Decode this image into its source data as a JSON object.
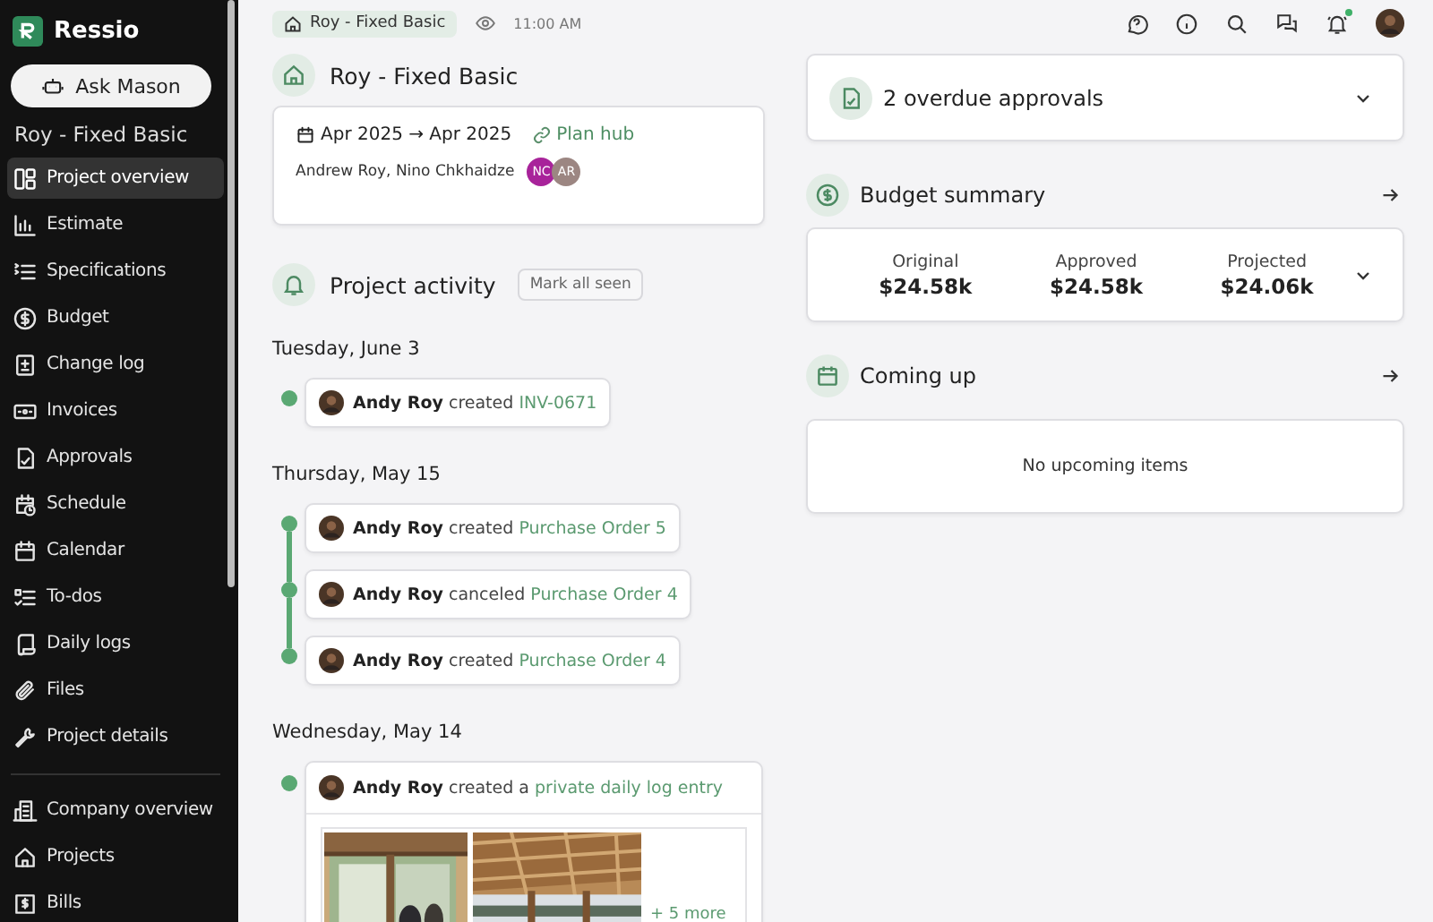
{
  "app": {
    "name": "Ressio"
  },
  "ask_button": {
    "label": "Ask Mason"
  },
  "sidebar_project": "Roy - Fixed Basic",
  "project_nav": [
    {
      "label": "Project overview",
      "selected": true
    },
    {
      "label": "Estimate",
      "selected": false
    },
    {
      "label": "Specifications",
      "selected": false
    },
    {
      "label": "Budget",
      "selected": false
    },
    {
      "label": "Change log",
      "selected": false
    },
    {
      "label": "Invoices",
      "selected": false
    },
    {
      "label": "Approvals",
      "selected": false
    },
    {
      "label": "Schedule",
      "selected": false
    },
    {
      "label": "Calendar",
      "selected": false
    },
    {
      "label": "To-dos",
      "selected": false
    },
    {
      "label": "Daily logs",
      "selected": false
    },
    {
      "label": "Files",
      "selected": false
    },
    {
      "label": "Project details",
      "selected": false
    }
  ],
  "company_nav": [
    {
      "label": "Company overview",
      "selected": false
    },
    {
      "label": "Projects",
      "selected": false
    },
    {
      "label": "Bills",
      "selected": false
    }
  ],
  "header": {
    "breadcrumb": "Roy - Fixed Basic",
    "time": "11:00 AM",
    "bell_unread": true
  },
  "project": {
    "title": "Roy - Fixed Basic",
    "dates": "Apr 2025 → Apr 2025",
    "plan_link": "Plan hub",
    "members": "Andrew Roy, Nino Chkhaidze",
    "avatars": [
      {
        "initials": "NC",
        "color": "#a8239a"
      },
      {
        "initials": "AR",
        "color": "#9c8682"
      }
    ]
  },
  "activity": {
    "title": "Project activity",
    "mark_button": "Mark all seen",
    "days": [
      {
        "date": "Tuesday, June 3",
        "entries": [
          {
            "actor": "Andy Roy",
            "action": "created",
            "link": "INV-0671"
          }
        ]
      },
      {
        "date": "Thursday, May 15",
        "entries": [
          {
            "actor": "Andy Roy",
            "action": "created",
            "link": "Purchase Order 5"
          },
          {
            "actor": "Andy Roy",
            "action": "canceled",
            "link": "Purchase Order 4"
          },
          {
            "actor": "Andy Roy",
            "action": "created",
            "link": "Purchase Order 4"
          }
        ]
      },
      {
        "date": "Wednesday, May 14",
        "entries": [
          {
            "actor": "Andy Roy",
            "action": "created a",
            "link": "private daily log entry",
            "more": "+ 5 more"
          }
        ]
      }
    ]
  },
  "approvals": {
    "title": "2 overdue approvals"
  },
  "budget": {
    "title": "Budget summary",
    "figures": [
      {
        "label": "Original",
        "value": "$24.58k"
      },
      {
        "label": "Approved",
        "value": "$24.58k"
      },
      {
        "label": "Projected",
        "value": "$24.06k"
      }
    ]
  },
  "coming_up": {
    "title": "Coming up",
    "empty": "No upcoming items"
  }
}
